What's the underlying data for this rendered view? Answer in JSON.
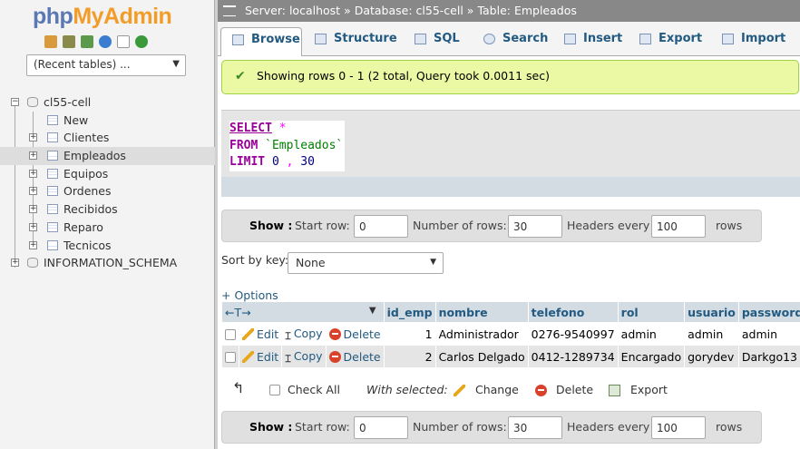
{
  "nav": {
    "logo_part1": "php",
    "logo_part2": "MyAdmin",
    "icons": [
      "home-icon",
      "logout-icon",
      "query-window-icon",
      "docs-icon",
      "copy-icon",
      "reload-icon"
    ],
    "recent_tables": "(Recent tables) ...",
    "tree": {
      "db1": "cl55-cell",
      "new": "New",
      "tables": [
        "Clientes",
        "Empleados",
        "Equipos",
        "Ordenes",
        "Recibidos",
        "Reparo",
        "Tecnicos"
      ],
      "db2": "INFORMATION_SCHEMA"
    }
  },
  "breadcrumb": {
    "server": "Server: localhost",
    "sep1": "»",
    "database": "Database: cl55-cell",
    "sep2": "»",
    "table": "Table: Empleados"
  },
  "tabs": [
    "Browse",
    "Structure",
    "SQL",
    "Search",
    "Insert",
    "Export",
    "Import"
  ],
  "message": "Showing rows 0 - 1 (2 total, Query took 0.0011 sec)",
  "sql": {
    "select": "SELECT",
    "star": "*",
    "from": "FROM",
    "table": "`Empleados`",
    "limit": "LIMIT",
    "offset": "0",
    "comma": ",",
    "count": "30"
  },
  "navbar": {
    "show": "Show :",
    "start_row_label": "Start row:",
    "start_row": "0",
    "num_rows_label": "Number of rows:",
    "num_rows": "30",
    "headers_label": "Headers every",
    "headers": "100",
    "rows_label": "rows"
  },
  "sort": {
    "label": "Sort by key:",
    "value": "None"
  },
  "options_link": "+ Options",
  "table": {
    "columns": [
      "id_emp",
      "nombre",
      "telefono",
      "rol",
      "usuario",
      "password"
    ],
    "nav_arrows": "←T→",
    "actions": {
      "edit": "Edit",
      "copy": "Copy",
      "delete": "Delete"
    },
    "rows": [
      [
        "1",
        "Administrador",
        "0276-9540997",
        "admin",
        "admin",
        "admin"
      ],
      [
        "2",
        "Carlos Delgado",
        "0412-1289734",
        "Encargado",
        "gorydev",
        "Darkgo13"
      ]
    ]
  },
  "bulk": {
    "check_all": "Check All",
    "with_selected": "With selected:",
    "change": "Change",
    "delete": "Delete",
    "export": "Export"
  }
}
